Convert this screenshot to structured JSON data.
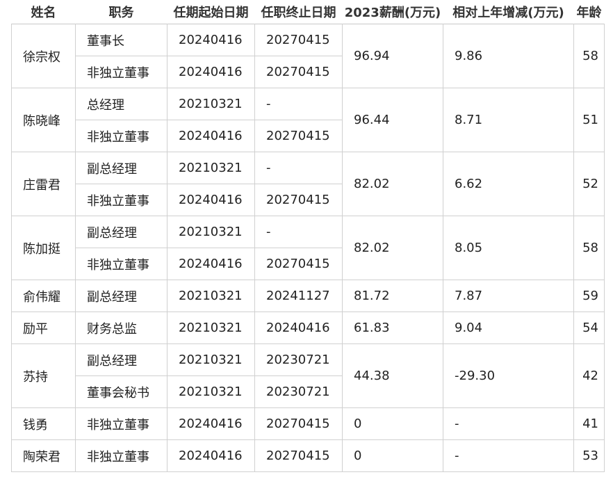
{
  "headers": {
    "name": "姓名",
    "position": "职务",
    "start_date": "任期起始日期",
    "end_date": "任职终止日期",
    "salary": "2023薪酬(万元)",
    "change": "相对上年增减(万元)",
    "age": "年龄"
  },
  "people": [
    {
      "name": "徐宗权",
      "salary": "96.94",
      "change": "9.86",
      "age": "58",
      "roles": [
        {
          "title": "董事长",
          "start": "20240416",
          "end": "20270415"
        },
        {
          "title": "非独立董事",
          "start": "20240416",
          "end": "20270415"
        }
      ]
    },
    {
      "name": "陈晓峰",
      "salary": "96.44",
      "change": "8.71",
      "age": "51",
      "roles": [
        {
          "title": "总经理",
          "start": "20210321",
          "end": "-"
        },
        {
          "title": "非独立董事",
          "start": "20240416",
          "end": "20270415"
        }
      ]
    },
    {
      "name": "庄雷君",
      "salary": "82.02",
      "change": "6.62",
      "age": "52",
      "roles": [
        {
          "title": "副总经理",
          "start": "20210321",
          "end": "-"
        },
        {
          "title": "非独立董事",
          "start": "20240416",
          "end": "20270415"
        }
      ]
    },
    {
      "name": "陈加挺",
      "salary": "82.02",
      "change": "8.05",
      "age": "58",
      "roles": [
        {
          "title": "副总经理",
          "start": "20210321",
          "end": "-"
        },
        {
          "title": "非独立董事",
          "start": "20240416",
          "end": "20270415"
        }
      ]
    },
    {
      "name": "俞伟耀",
      "salary": "81.72",
      "change": "7.87",
      "age": "59",
      "roles": [
        {
          "title": "副总经理",
          "start": "20210321",
          "end": "20241127"
        }
      ]
    },
    {
      "name": "励平",
      "salary": "61.83",
      "change": "9.04",
      "age": "54",
      "roles": [
        {
          "title": "财务总监",
          "start": "20210321",
          "end": "20240416"
        }
      ]
    },
    {
      "name": "苏持",
      "salary": "44.38",
      "change": "-29.30",
      "age": "42",
      "roles": [
        {
          "title": "副总经理",
          "start": "20210321",
          "end": "20230721"
        },
        {
          "title": "董事会秘书",
          "start": "20210321",
          "end": "20230721"
        }
      ]
    },
    {
      "name": "钱勇",
      "salary": "0",
      "change": "-",
      "age": "41",
      "roles": [
        {
          "title": "非独立董事",
          "start": "20240416",
          "end": "20270415"
        }
      ]
    },
    {
      "name": "陶荣君",
      "salary": "0",
      "change": "-",
      "age": "53",
      "roles": [
        {
          "title": "非独立董事",
          "start": "20240416",
          "end": "20270415"
        }
      ]
    }
  ]
}
